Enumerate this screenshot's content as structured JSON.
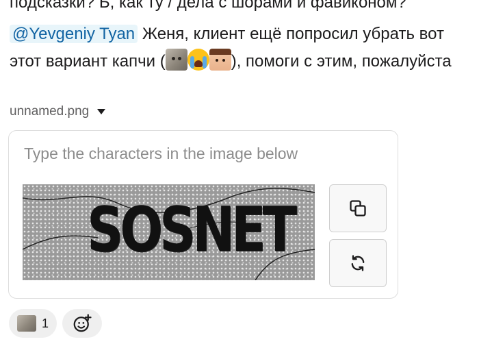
{
  "message": {
    "clipped_previous_line": "подсказки? Б, как ту / дела с шорами и фавиконом?",
    "mention": "@Yevgeniy Tyan",
    "text_before_emoji": " Женя, клиент ещё попросил убрать вот этот вариант капчи (",
    "text_after_emoji": "), помоги с этим, пожалуйста",
    "inline_emojis": [
      "cat-photo-emoji",
      "loudly-crying-face-emoji",
      "child-face-emoji"
    ]
  },
  "attachment": {
    "filename": "unnamed.png",
    "captcha": {
      "instruction": "Type the characters in the image below",
      "code": "SOSNET"
    }
  },
  "reactions": [
    {
      "emoji": "cat-photo-emoji",
      "count": "1"
    }
  ],
  "colors": {
    "mention_bg": "#e8f5fa",
    "mention_text": "#1264a3",
    "reaction_bg": "#efefef"
  }
}
